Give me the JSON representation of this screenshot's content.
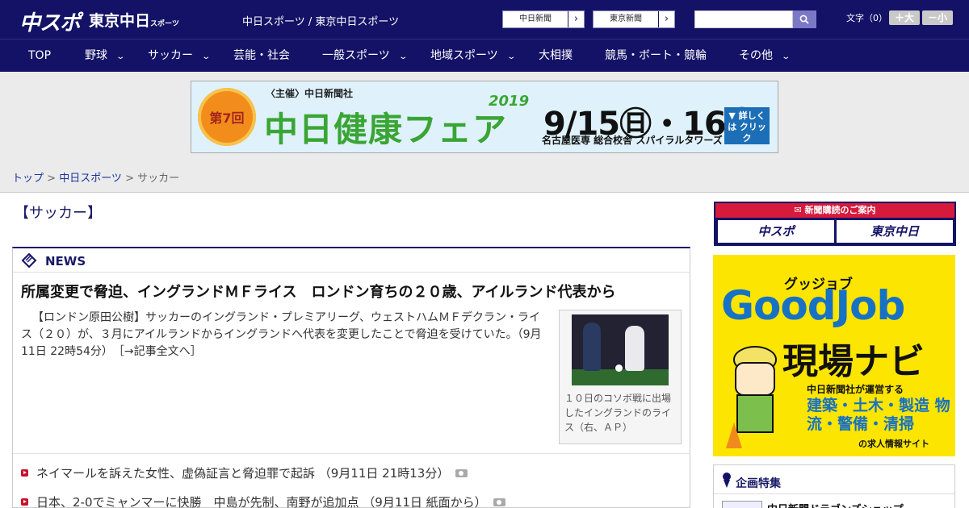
{
  "header": {
    "logo_main": "中スポ",
    "logo_tokyo": "東京中日",
    "logo_tokyo_small": "スポーツ",
    "site_links": "中日スポーツ / 東京中日スポーツ",
    "paper_links": [
      {
        "label": "中日新聞"
      },
      {
        "label": "東京新聞"
      }
    ],
    "search": {
      "value": "",
      "placeholder": ""
    },
    "font_size_label": "文字（0）",
    "font_larger": "＋大",
    "font_smaller": "－小"
  },
  "nav": {
    "items": [
      {
        "label": "TOP",
        "has_dropdown": false
      },
      {
        "label": "野球",
        "has_dropdown": true
      },
      {
        "label": "サッカー",
        "has_dropdown": true
      },
      {
        "label": "芸能・社会",
        "has_dropdown": false
      },
      {
        "label": "一般スポーツ",
        "has_dropdown": true
      },
      {
        "label": "地域スポーツ",
        "has_dropdown": true
      },
      {
        "label": "大相撲",
        "has_dropdown": false
      },
      {
        "label": "競馬・ボート・競輪",
        "has_dropdown": false
      },
      {
        "label": "その他",
        "has_dropdown": true
      }
    ],
    "chevron": "⌄"
  },
  "banner": {
    "badge": "第7回",
    "organizer": "〈主催〉中日新聞社",
    "title": "中日健康フェア",
    "year": "2019",
    "dates": "9/15㊐・16㊗",
    "venue": "名古屋医専 総合校舎 スパイラルタワーズ",
    "cta": "▼ 詳しくは クリック"
  },
  "breadcrumb": {
    "home": "トップ",
    "sep": " > ",
    "parent": "中日スポーツ",
    "current": "サッカー"
  },
  "page": {
    "section_title": "【サッカー】"
  },
  "news": {
    "label": "NEWS",
    "top": {
      "headline": "所属変更で脅迫、イングランドＭＦライス　ロンドン育ちの２０歳、アイルランド代表から",
      "lead": "【ロンドン原田公樹】サッカーのイングランド・プレミアリーグ、ウェストハムＭＦデクラン・ライス（２０）が、３月にアイルランドからイングランドへ代表を変更したことで脅迫を受けていた。（9月11日 22時54分）",
      "more_link": "［→記事全文へ］",
      "photo_caption": "１０日のコソボ戦に出場したイングランドのライス（右、ＡＰ）"
    },
    "items": [
      {
        "text": "ネイマールを訴えた女性、虚偽証言と脅迫罪で起訴 （9月11日 21時13分）",
        "has_photo": true
      },
      {
        "text": "日本、2-0でミャンマーに快勝　中島が先制、南野が追加点 （9月11日 紙面から）",
        "has_photo": true
      }
    ]
  },
  "sidebar": {
    "subscribe_header": "新聞購読のご案内",
    "subscribe_buttons": [
      {
        "label": "中スポ"
      },
      {
        "label": "東京中日"
      }
    ],
    "goodjob": {
      "sub": "グッジョブ",
      "main": "GoodJob",
      "navi": "現場ナビ",
      "desc": "中日新聞社が運営する",
      "fields": "建築・土木・製造 物流・警備・清掃",
      "site": "の求人情報サイト"
    },
    "feature": {
      "title": "企画特集",
      "item": "中日新聞ドラゴンズショップ"
    }
  },
  "colors": {
    "header_bg": "#141266",
    "accent_red": "#c8102e",
    "link_blue": "#1a3399",
    "goodjob_yellow": "#fce500"
  }
}
